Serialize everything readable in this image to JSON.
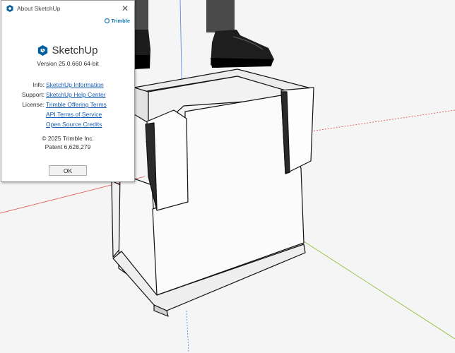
{
  "dialog": {
    "title": "About SketchUp",
    "close_glyph": "✕",
    "vendor_logo": "Trimble",
    "product_name": "SketchUp",
    "version": "Version 25.0.660 64-bit",
    "rows": [
      {
        "label": "Info:",
        "link": "SketchUp Information"
      },
      {
        "label": "Support:",
        "link": "SketchUp Help Center"
      },
      {
        "label": "License:",
        "link": "Trimble Offering Terms"
      },
      {
        "label": "",
        "link": "API Terms of Service"
      },
      {
        "label": "",
        "link": "Open Source Credits"
      }
    ],
    "copyright": "© 2025 Trimble Inc.",
    "patent": "Patent 6,628,279",
    "ok_label": "OK"
  },
  "colors": {
    "link": "#1a5db0",
    "trimble_blue": "#1a7bb0",
    "sketchup_logo": "#005f9e",
    "axis_red": "#e05a5a",
    "axis_green": "#8fbf3a",
    "axis_blue": "#5a8fe0"
  },
  "icons": [
    "sketchup-logo-icon",
    "trimble-logo-icon",
    "close-icon"
  ]
}
